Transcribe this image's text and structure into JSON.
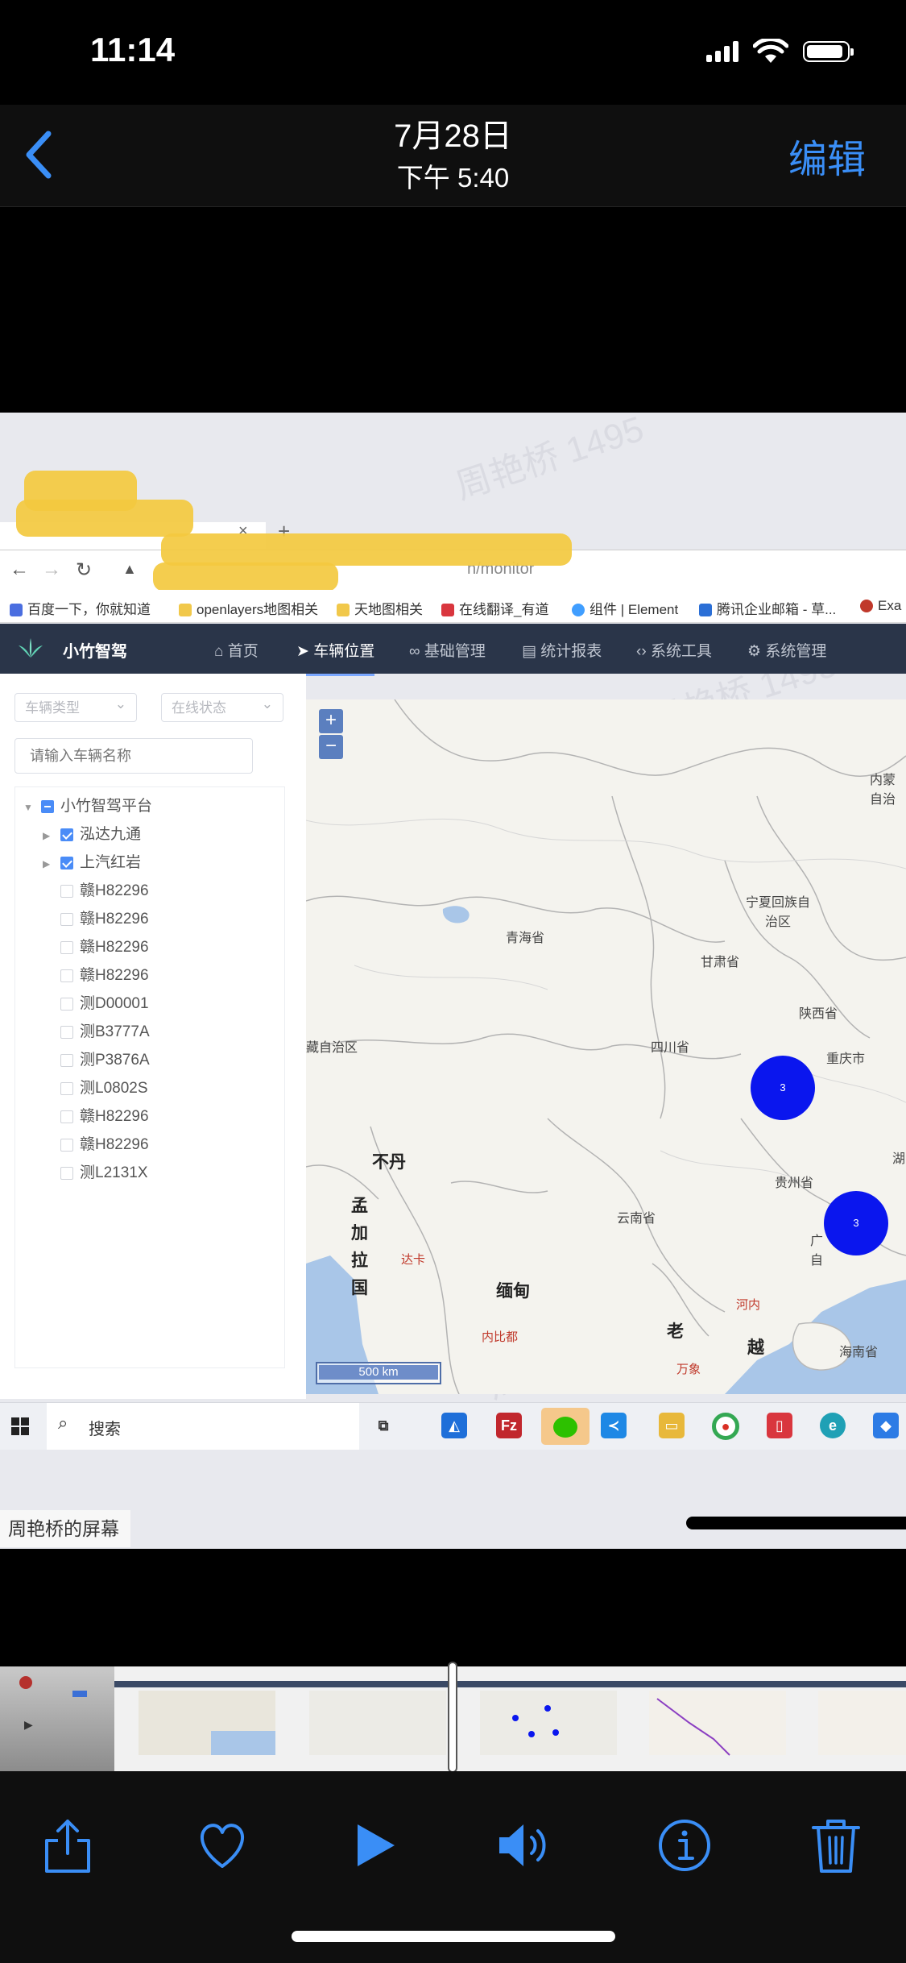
{
  "status_bar": {
    "time": "11:14",
    "icons": [
      "cellular-signal-icon",
      "wifi-icon",
      "battery-icon"
    ]
  },
  "nav": {
    "date": "7月28日",
    "time": "下午 5:40",
    "edit_label": "编辑"
  },
  "video": {
    "watermark": "周艳桥 1495",
    "browser": {
      "new_tab": "+",
      "url_fragment": "n/monitor",
      "bookmarks": [
        "百度一下，你就知道",
        "openlayers地图相关",
        "天地图相关",
        "在线翻译_有道",
        "组件 | Element",
        "腾讯企业邮箱 - 草...",
        "Exa"
      ]
    },
    "app": {
      "name": "小竹智驾",
      "menu": [
        "首页",
        "车辆位置",
        "基础管理",
        "统计报表",
        "系统工具",
        "系统管理"
      ],
      "active_menu": "车辆位置"
    },
    "filters": {
      "vehicle_type_placeholder": "车辆类型",
      "online_status_placeholder": "在线状态",
      "vehicle_name_placeholder": "请输入车辆名称"
    },
    "tree": {
      "root": "小竹智驾平台",
      "groups": [
        "泓达九通",
        "上汽红岩"
      ],
      "vehicles": [
        "赣H82296",
        "赣H82296",
        "赣H82296",
        "赣H82296",
        "测D00001",
        "测B3777A",
        "测P3876A",
        "测L0802S",
        "赣H82296",
        "赣H82296",
        "测L2131X"
      ]
    },
    "map": {
      "zoom_in": "+",
      "zoom_out": "−",
      "labels": [
        "青海省",
        "甘肃省",
        "宁夏回族自治区",
        "陕西省",
        "四川省",
        "重庆市",
        "藏自治区",
        "贵州省",
        "云南省",
        "内蒙自治",
        "湖",
        "广自",
        "海南省"
      ],
      "country_labels": [
        "不丹",
        "孟加拉国",
        "缅甸",
        "老",
        "越"
      ],
      "city_labels": [
        "达卡",
        "内比都",
        "河内",
        "万象"
      ],
      "clusters": [
        {
          "count": "3"
        },
        {
          "count": "3"
        }
      ],
      "scale": "500 km"
    },
    "taskbar": {
      "search_label": "搜索"
    },
    "screen_share_label": "周艳桥的屏幕"
  },
  "toolbar": {
    "tools": [
      "share-icon",
      "heart-icon",
      "play-icon",
      "speaker-icon",
      "info-icon",
      "trash-icon"
    ]
  },
  "colors": {
    "accent": "#3a8ef6",
    "cluster": "#0a16ee",
    "app_header": "#2a3549",
    "checkbox": "#4a8cf7"
  }
}
